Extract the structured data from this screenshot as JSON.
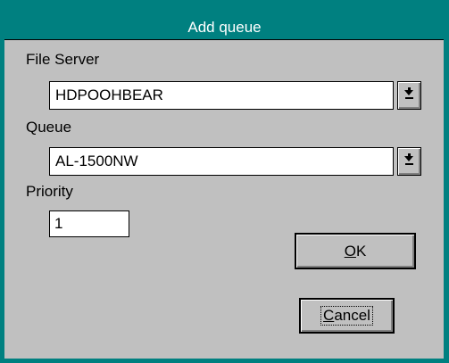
{
  "dialog": {
    "title": "Add queue"
  },
  "fields": {
    "file_server_label": "File Server",
    "file_server_value": "HDPOOHBEAR",
    "queue_label": "Queue",
    "queue_value": "AL-1500NW",
    "priority_label": "Priority",
    "priority_value": "1"
  },
  "buttons": {
    "ok_mnemonic": "O",
    "ok_rest": "K",
    "cancel_mnemonic": "C",
    "cancel_rest": "ancel"
  },
  "icons": {
    "dropdown": "dropdown-arrow-icon"
  },
  "colors": {
    "title_bar": "#008080",
    "dialog_face": "#c0c0c0"
  }
}
